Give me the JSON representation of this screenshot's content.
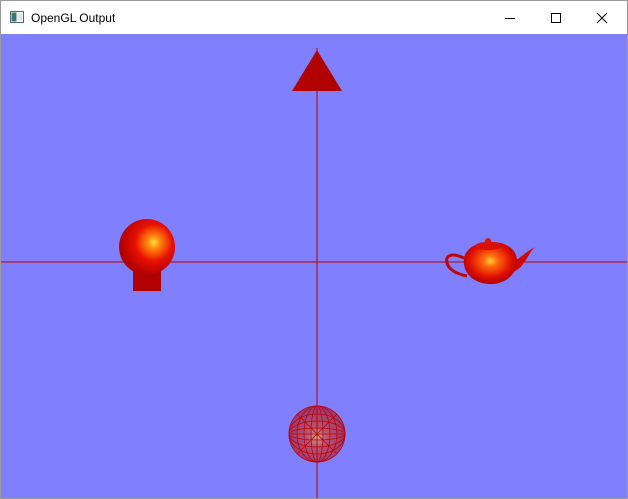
{
  "window": {
    "title": "OpenGL Output",
    "controls": {
      "minimize": "minimize-icon",
      "maximize": "maximize-icon",
      "close": "close-icon"
    }
  },
  "scene": {
    "background_color": "#8080ff",
    "axis_color": "#b00000",
    "objects": [
      {
        "name": "cone",
        "color": "#b00000",
        "style": "solid"
      },
      {
        "name": "sphere-on-cube",
        "color": "#e00000",
        "style": "solid"
      },
      {
        "name": "teapot",
        "color": "#e00000",
        "style": "solid"
      },
      {
        "name": "wire-sphere",
        "color": "#c00000",
        "style": "wireframe"
      }
    ]
  }
}
